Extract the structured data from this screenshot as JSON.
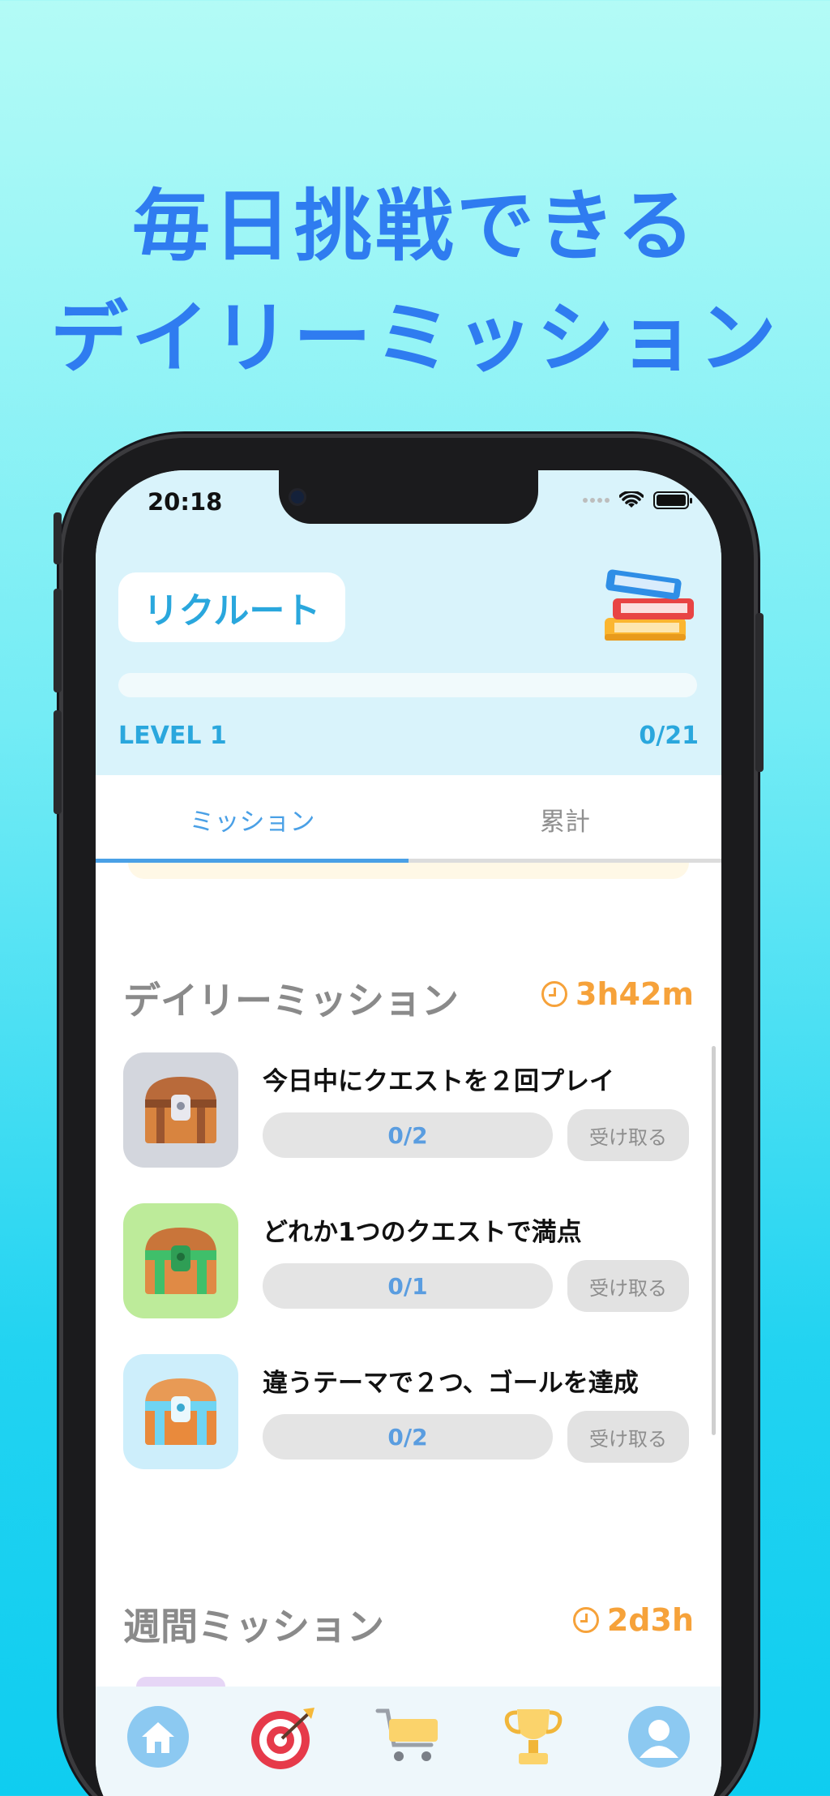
{
  "headline": {
    "line1": "毎日挑戦できる",
    "line2": "デイリーミッション"
  },
  "status_bar": {
    "time": "20:18"
  },
  "header": {
    "company": "リクルート",
    "level": "LEVEL 1",
    "progress_count": "0/21",
    "progress_fraction": 0
  },
  "tabs": [
    {
      "label": "ミッション",
      "active": true
    },
    {
      "label": "累計",
      "active": false
    }
  ],
  "daily": {
    "title": "デイリーミッション",
    "timer": "3h42m",
    "missions": [
      {
        "title": "今日中にクエストを２回プレイ",
        "progress": "0/2",
        "button": "受け取る",
        "icon": "treasure-chest-brown-icon",
        "icon_bg": "#d3d6dd"
      },
      {
        "title": "どれか1つのクエストで満点",
        "progress": "0/1",
        "button": "受け取る",
        "icon": "treasure-chest-green-icon",
        "icon_bg": "#bdeb9a"
      },
      {
        "title": "違うテーマで２つ、ゴールを達成",
        "progress": "0/2",
        "button": "受け取る",
        "icon": "treasure-chest-blue-icon",
        "icon_bg": "#cdeefb"
      }
    ]
  },
  "weekly": {
    "title": "週間ミッション",
    "timer": "2d3h"
  },
  "tabbar": [
    {
      "icon": "home-icon"
    },
    {
      "icon": "target-icon"
    },
    {
      "icon": "cart-icon"
    },
    {
      "icon": "trophy-icon"
    },
    {
      "icon": "profile-icon"
    }
  ],
  "colors": {
    "accent_blue": "#2f7cf0",
    "company_blue": "#2aa7dd",
    "timer_orange": "#f6a23a",
    "progress_text": "#5a9de0"
  }
}
